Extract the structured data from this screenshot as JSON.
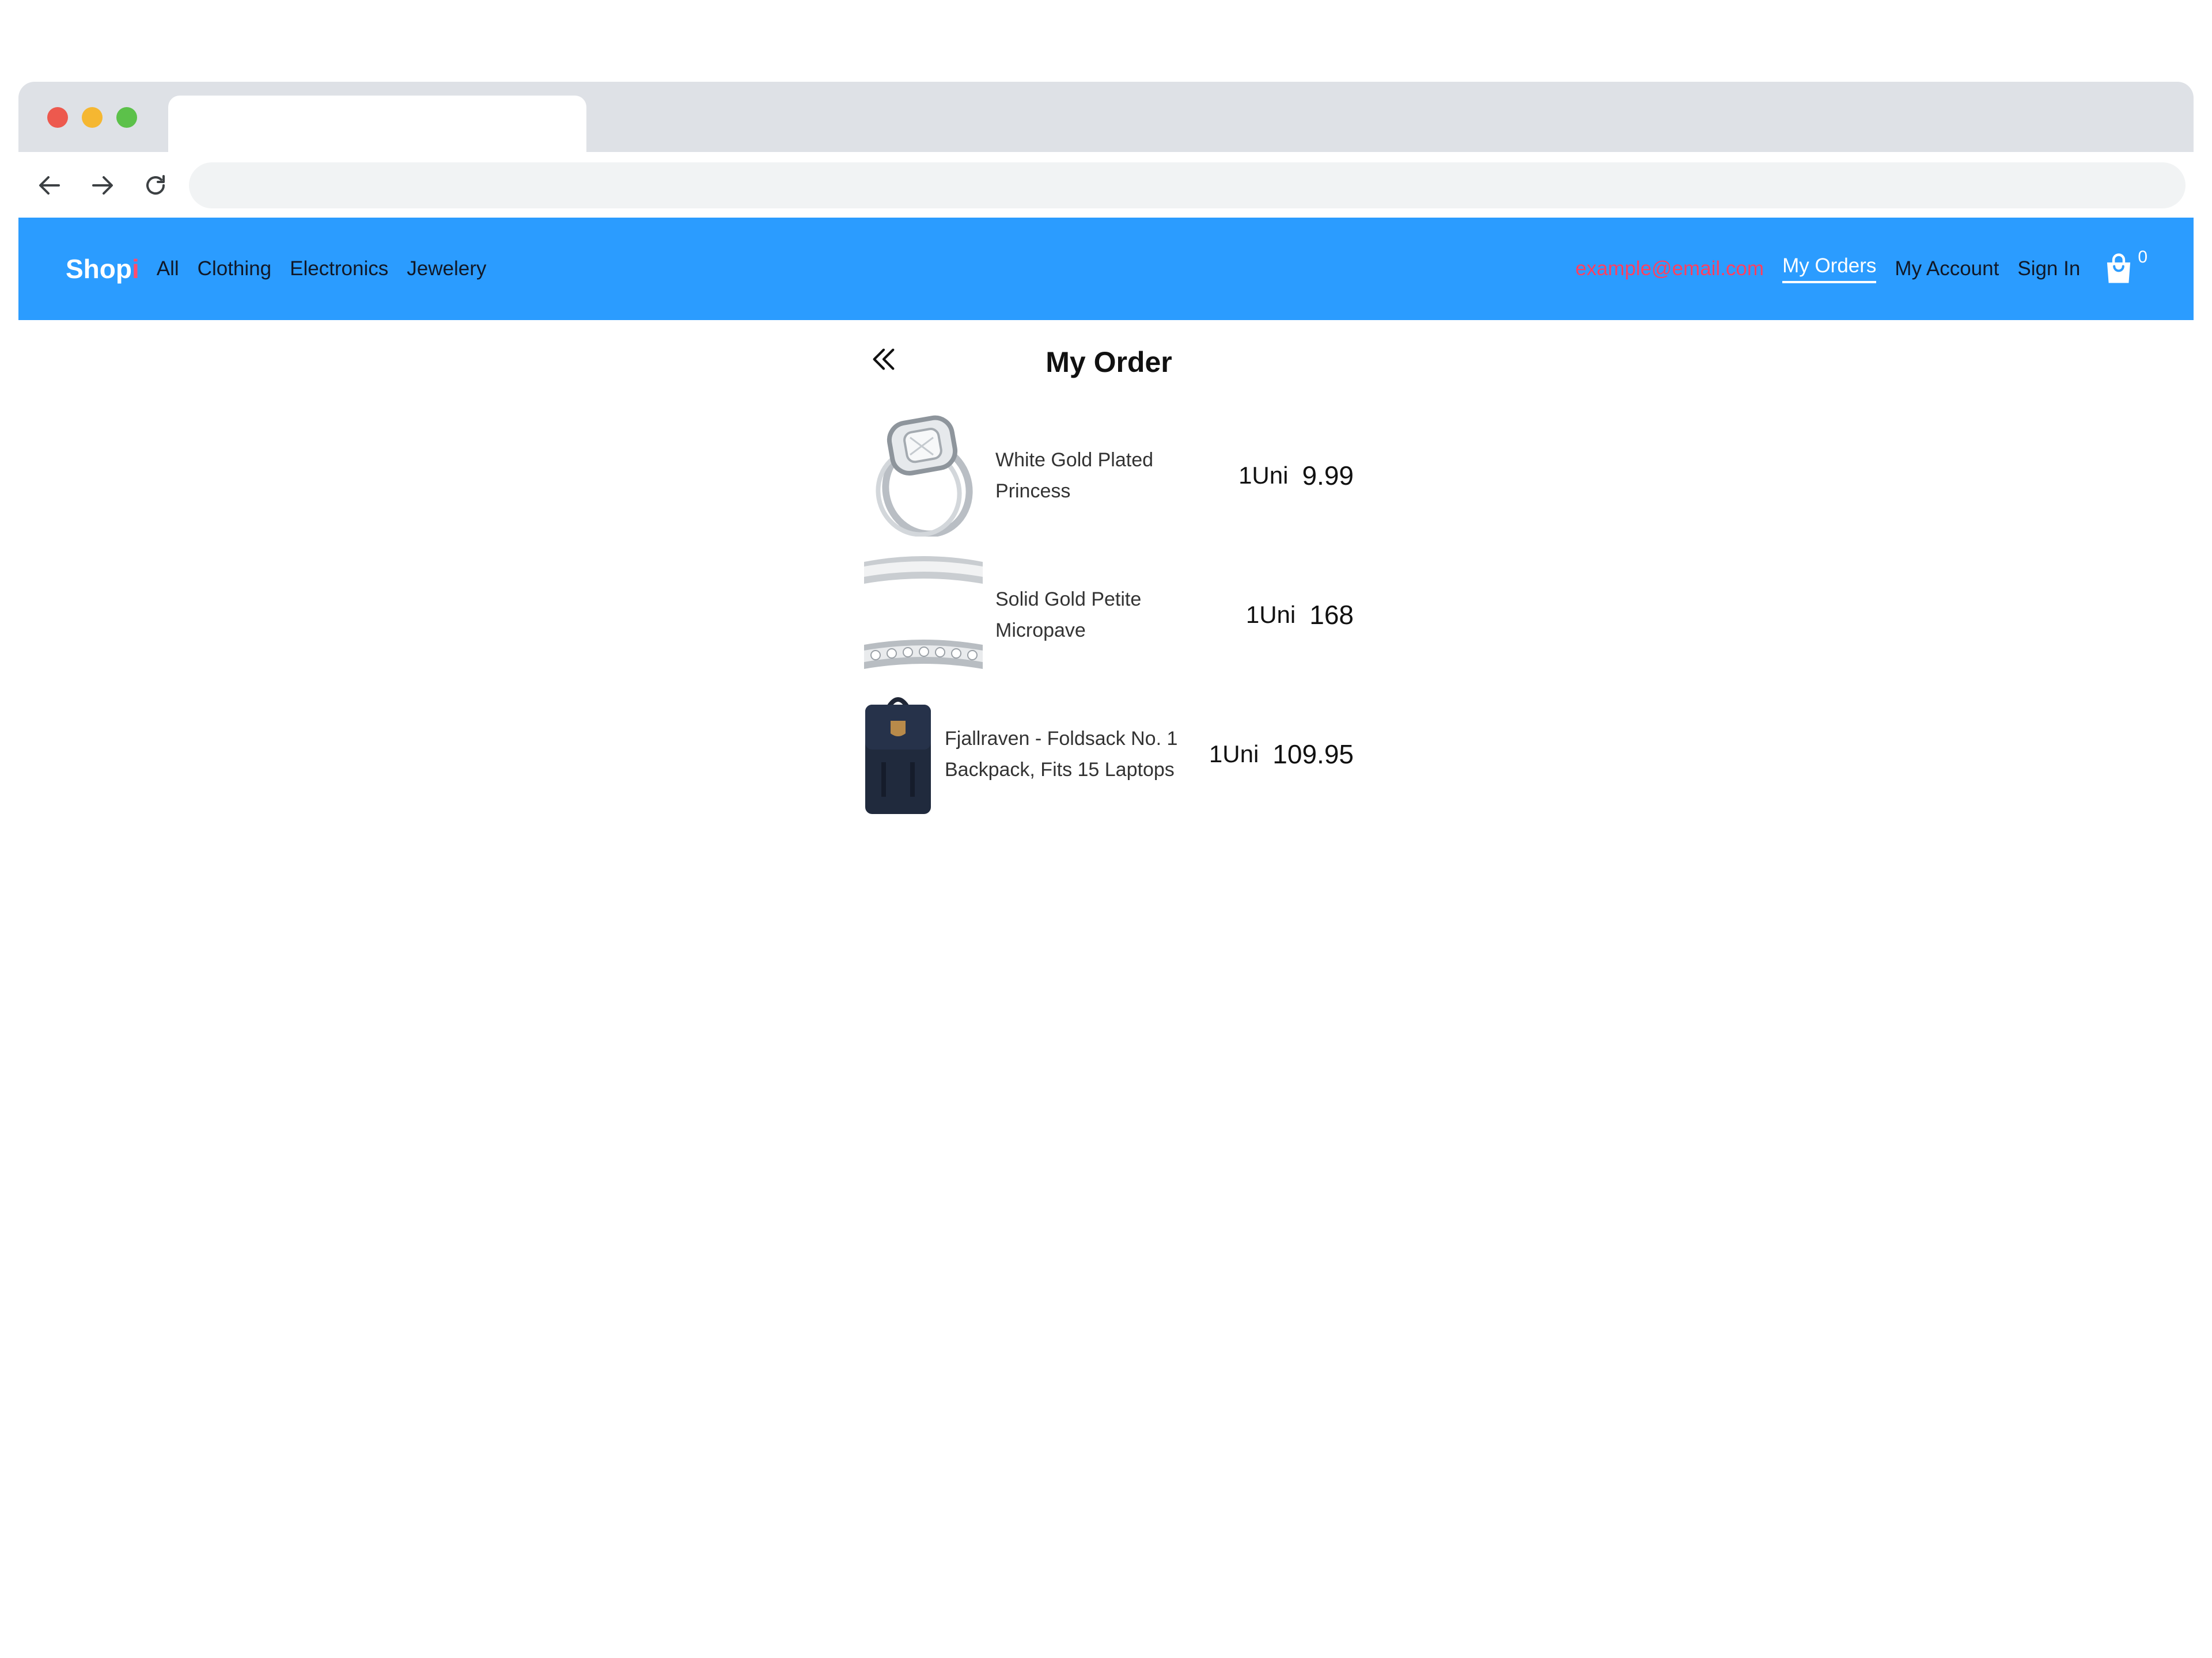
{
  "browser": {
    "tab_title": "",
    "address": ""
  },
  "nav": {
    "logo_main": "Shop",
    "logo_accent": "i",
    "links": [
      "All",
      "Clothing",
      "Electronics",
      "Jewelery"
    ],
    "email": "example@email.com",
    "my_orders": "My Orders",
    "my_account": "My Account",
    "sign_in": "Sign In",
    "cart_count": "0"
  },
  "order": {
    "title": "My Order",
    "items": [
      {
        "name": "White Gold Plated Princess",
        "qty": "1Uni",
        "price": "9.99",
        "image_icon": "ring-icon"
      },
      {
        "name": "Solid Gold Petite Micropave",
        "qty": "1Uni",
        "price": "168",
        "image_icon": "band-ring-icon"
      },
      {
        "name": "Fjallraven - Foldsack No. 1 Backpack, Fits 15 Laptops",
        "qty": "1Uni",
        "price": "109.95",
        "image_icon": "backpack-icon"
      }
    ]
  },
  "colors": {
    "header_bg": "#2b9cff",
    "email_color": "#ff4060",
    "logo_accent": "#ff4d6d"
  }
}
